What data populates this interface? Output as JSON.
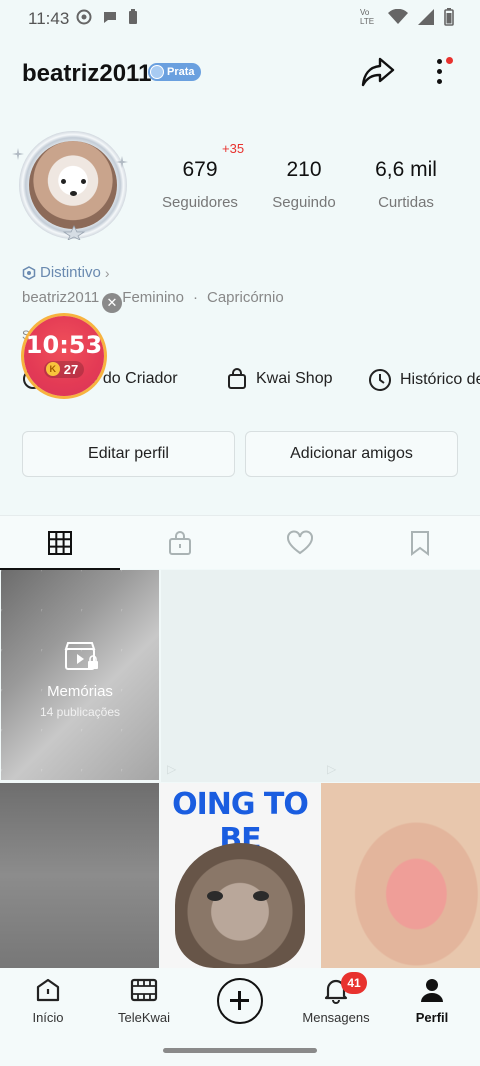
{
  "status_bar": {
    "time": "11:43",
    "network_label": "Vo LTE"
  },
  "profile": {
    "username": "beatriz2011",
    "level_badge": "Prata",
    "new_followers": "+35",
    "stats": [
      {
        "value": "679",
        "label": "Seguidores"
      },
      {
        "value": "210",
        "label": "Seguindo"
      },
      {
        "value": "6,6 mil",
        "label": "Curtidas"
      }
    ],
    "distintivo": "Distintivo",
    "id_fragment": "beatriz2011",
    "gender": "Feminino",
    "sign": "Capricórnio",
    "bio_fragment": "S"
  },
  "timer": {
    "time": "10:53",
    "coin_symbol": "K",
    "coins": "27"
  },
  "quick_links": [
    {
      "label": "Central do Criador",
      "visible": "al do Criador"
    },
    {
      "label": "Kwai Shop"
    },
    {
      "label": "Histórico de"
    }
  ],
  "buttons": {
    "edit_profile": "Editar perfil",
    "add_friends": "Adicionar amigos"
  },
  "grid": {
    "memorias_title": "Memórias",
    "memorias_sub": "14 publicações",
    "post2_caption": "OING TO BE"
  },
  "bottom_nav": {
    "items": [
      "Início",
      "TeleKwai",
      "",
      "Mensagens",
      "Perfil"
    ],
    "messages_badge": "41"
  },
  "colors": {
    "accent_red": "#e8322e",
    "badge_blue": "#6aa0df",
    "background": "#f1f9f9"
  }
}
